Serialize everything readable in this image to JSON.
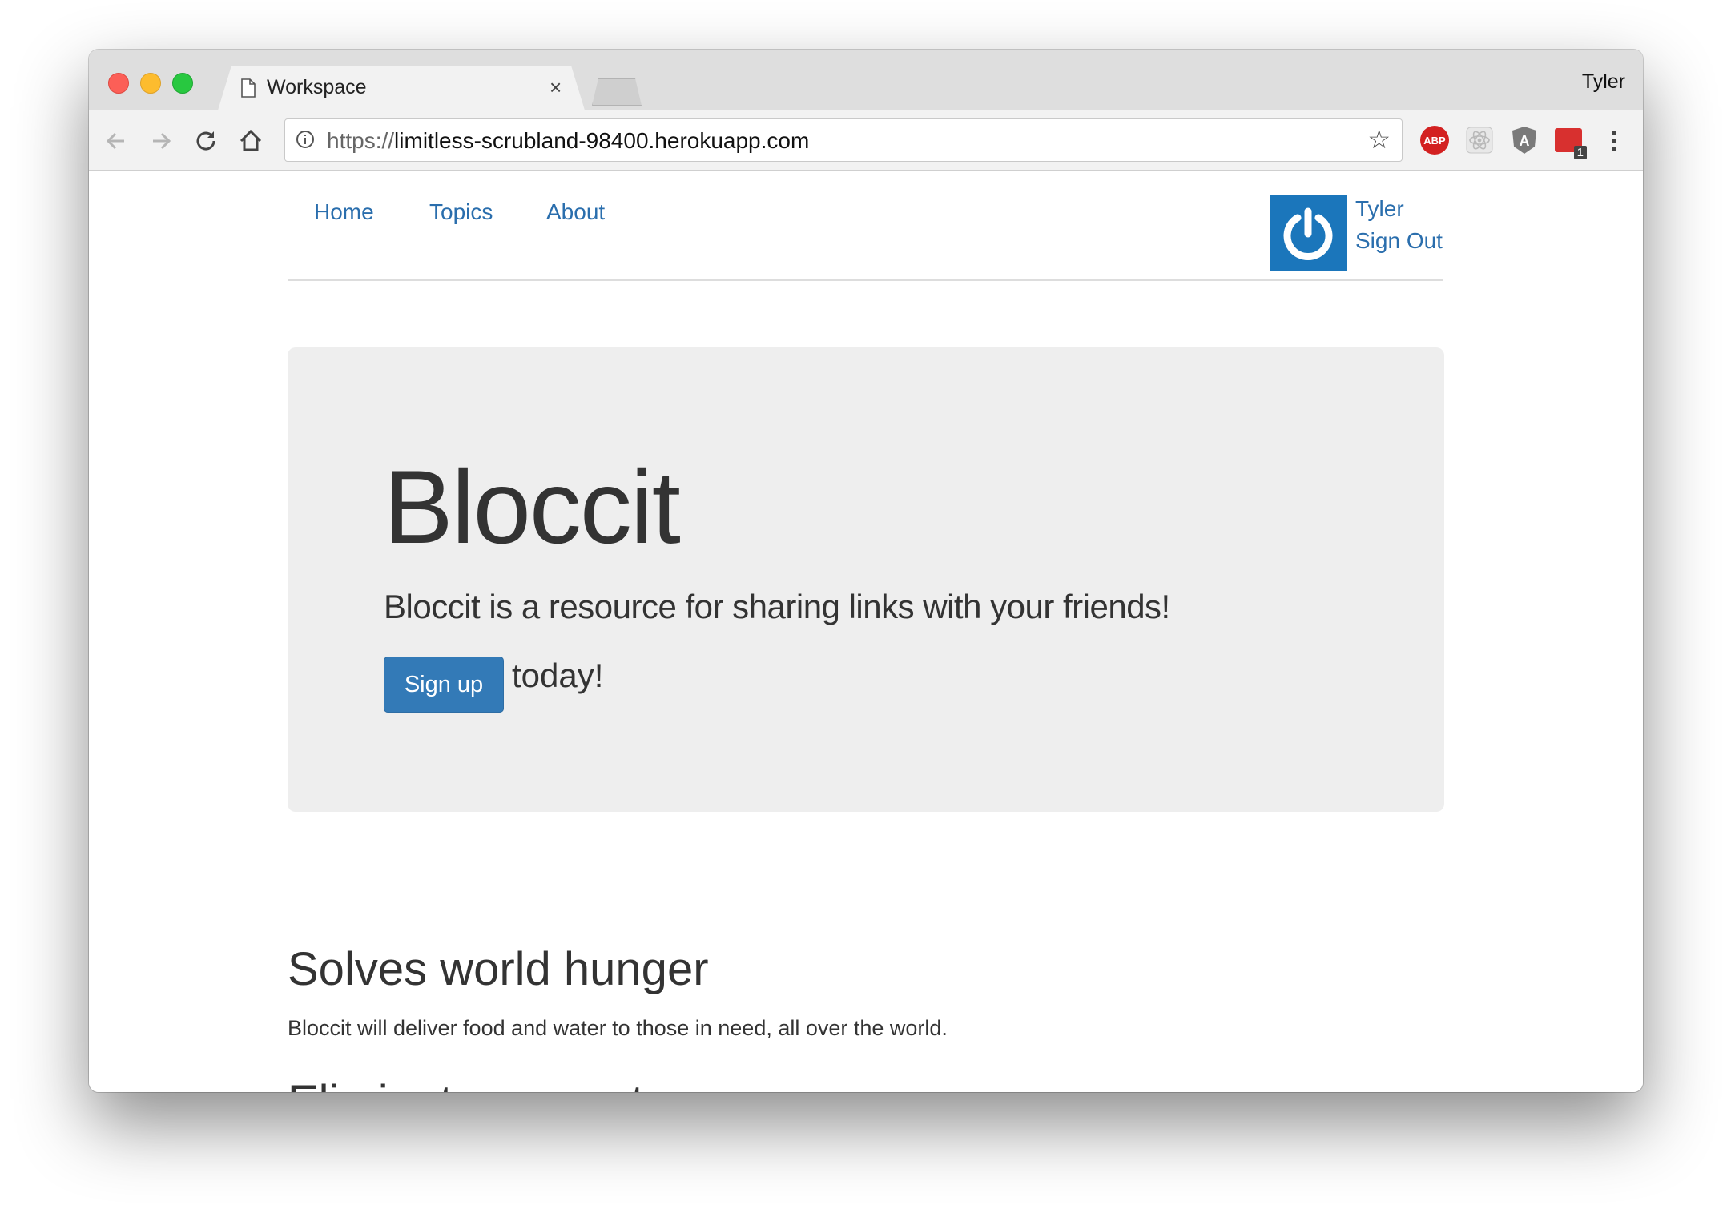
{
  "browser": {
    "tab_title": "Workspace",
    "tab_close": "×",
    "profile_name": "Tyler",
    "url_scheme": "https://",
    "url_host": "limitless-scrubland-98400.herokuapp.com",
    "extensions": [
      {
        "name": "adblock-plus-icon",
        "label": "ABP",
        "color": "#d32121"
      },
      {
        "name": "react-devtools-icon",
        "color": "#b9b9b9"
      },
      {
        "name": "angular-icon",
        "label": "A",
        "color": "#7a7a7a"
      },
      {
        "name": "mail-extension-icon",
        "badge": "1",
        "color": "#d8302f"
      }
    ],
    "accent": "#337ab7"
  },
  "nav": {
    "home": "Home",
    "topics": "Topics",
    "about": "About",
    "user_name": "Tyler",
    "sign_out": "Sign Out"
  },
  "jumbotron": {
    "title": "Bloccit",
    "lead": "Bloccit is a resource for sharing links with your friends!",
    "signup_label": "Sign up",
    "today": "today!"
  },
  "features": [
    {
      "heading": "Solves world hunger",
      "text": "Bloccit will deliver food and water to those in need, all over the world."
    },
    {
      "heading": "Eliminates poverty"
    }
  ]
}
